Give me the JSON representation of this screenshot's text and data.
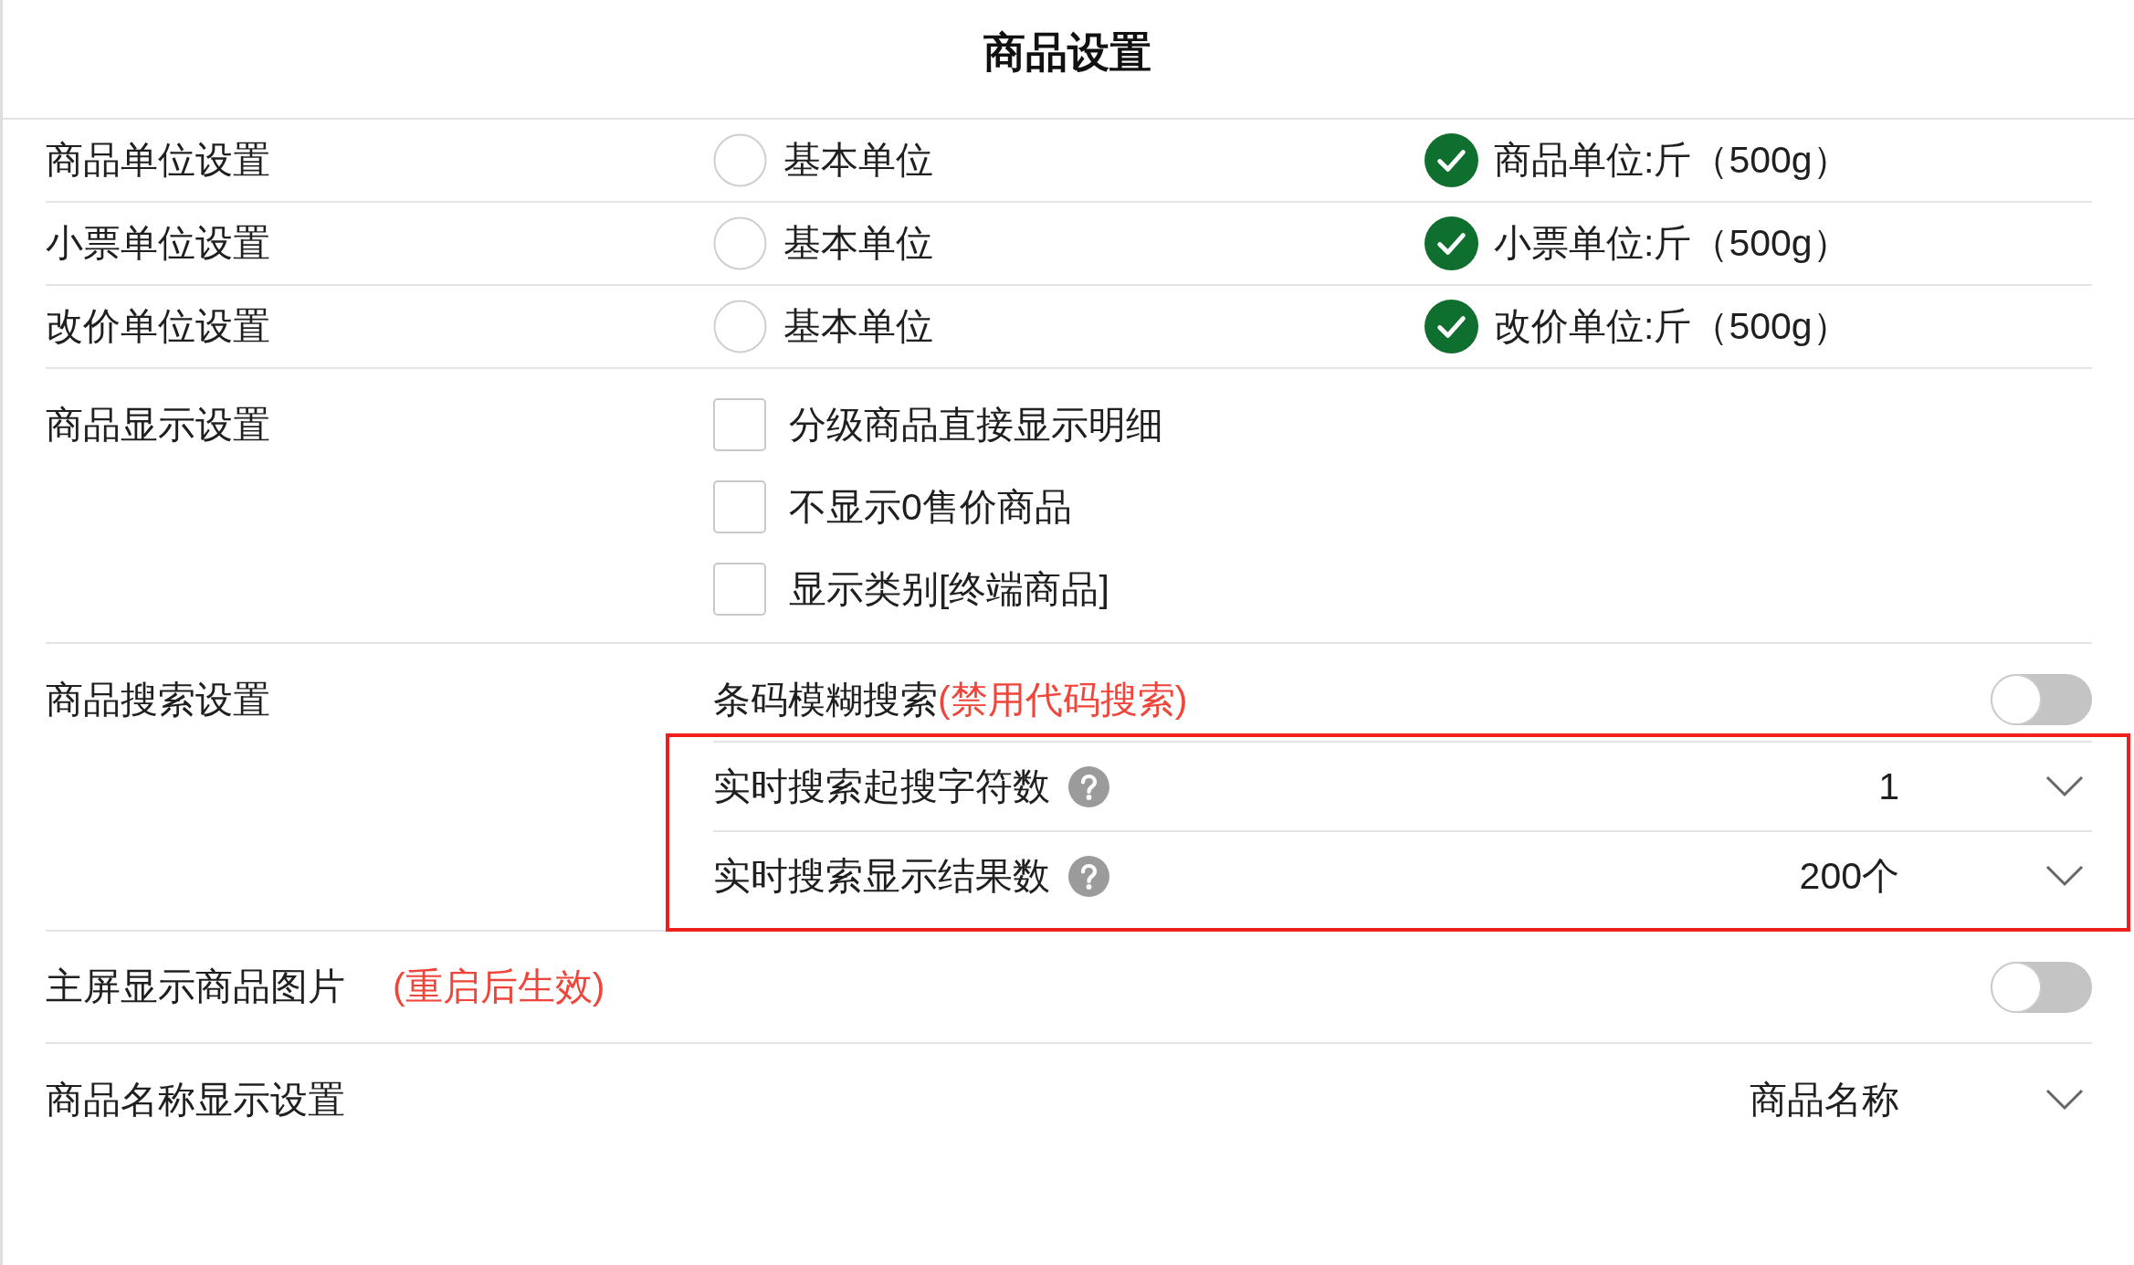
{
  "title": "商品设置",
  "settings": [
    {
      "kind": "radio",
      "label": "商品单位设置",
      "options": [
        {
          "label": "基本单位",
          "selected": false
        },
        {
          "label": "商品单位:斤（500g）",
          "selected": true
        }
      ]
    },
    {
      "kind": "radio",
      "label": "小票单位设置",
      "options": [
        {
          "label": "基本单位",
          "selected": false
        },
        {
          "label": "小票单位:斤（500g）",
          "selected": true
        }
      ]
    },
    {
      "kind": "radio",
      "label": "改价单位设置",
      "options": [
        {
          "label": "基本单位",
          "selected": false
        },
        {
          "label": "改价单位:斤（500g）",
          "selected": true
        }
      ]
    },
    {
      "kind": "checkboxes",
      "label": "商品显示设置",
      "options": [
        {
          "label": "分级商品直接显示明细",
          "checked": false
        },
        {
          "label": "不显示0售价商品",
          "checked": false
        },
        {
          "label": "显示类别[终端商品]",
          "checked": false
        }
      ]
    },
    {
      "kind": "search",
      "label": "商品搜索设置",
      "toggle": {
        "label": "条码模糊搜索",
        "note": "(禁用代码搜索)",
        "on": false
      },
      "realtime": {
        "highlighted": true,
        "items": [
          {
            "label": "实时搜索起搜字符数",
            "value": "1"
          },
          {
            "label": "实时搜索显示结果数",
            "value": "200个"
          }
        ]
      }
    },
    {
      "kind": "toggle",
      "label": "主屏显示商品图片",
      "note": "(重启后生效)",
      "on": false
    },
    {
      "kind": "select",
      "label": "商品名称显示设置",
      "value": "商品名称"
    }
  ]
}
